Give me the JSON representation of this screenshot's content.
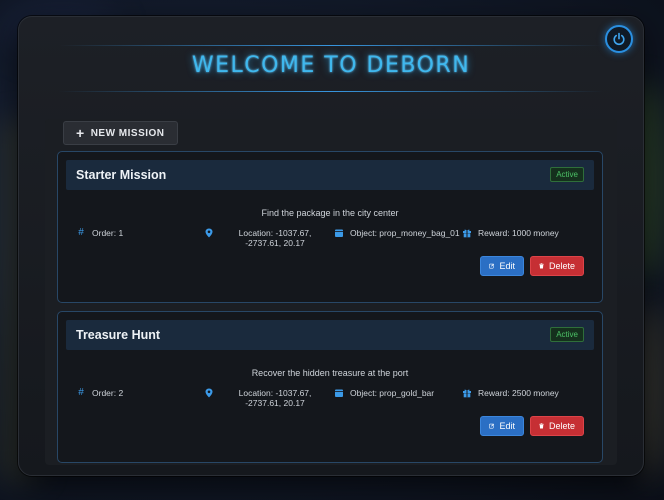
{
  "app": {
    "title": "WELCOME TO DEBORN"
  },
  "toolbar": {
    "new_mission_label": "NEW MISSION"
  },
  "icons": {
    "power": "power-icon",
    "plus": "plus-icon",
    "order": "hash-icon",
    "location": "map-pin-icon",
    "object": "box-icon",
    "reward": "gift-icon",
    "edit": "edit-icon",
    "delete": "trash-icon"
  },
  "colors": {
    "accent": "#3fb8ee",
    "edit": "#2b6fc4",
    "delete": "#c62f34",
    "active": "#4cc266"
  },
  "missions": [
    {
      "title": "Starter Mission",
      "status": "Active",
      "description": "Find the package in the city center",
      "order": "Order: 1",
      "location": "Location: -1037.67, -2737.61, 20.17",
      "object": "Object: prop_money_bag_01",
      "reward": "Reward: 1000 money",
      "edit_label": "Edit",
      "delete_label": "Delete"
    },
    {
      "title": "Treasure Hunt",
      "status": "Active",
      "description": "Recover the hidden treasure at the port",
      "order": "Order: 2",
      "location": "Location: -1037.67, -2737.61, 20.17",
      "object": "Object: prop_gold_bar",
      "reward": "Reward: 2500 money",
      "edit_label": "Edit",
      "delete_label": "Delete"
    }
  ]
}
